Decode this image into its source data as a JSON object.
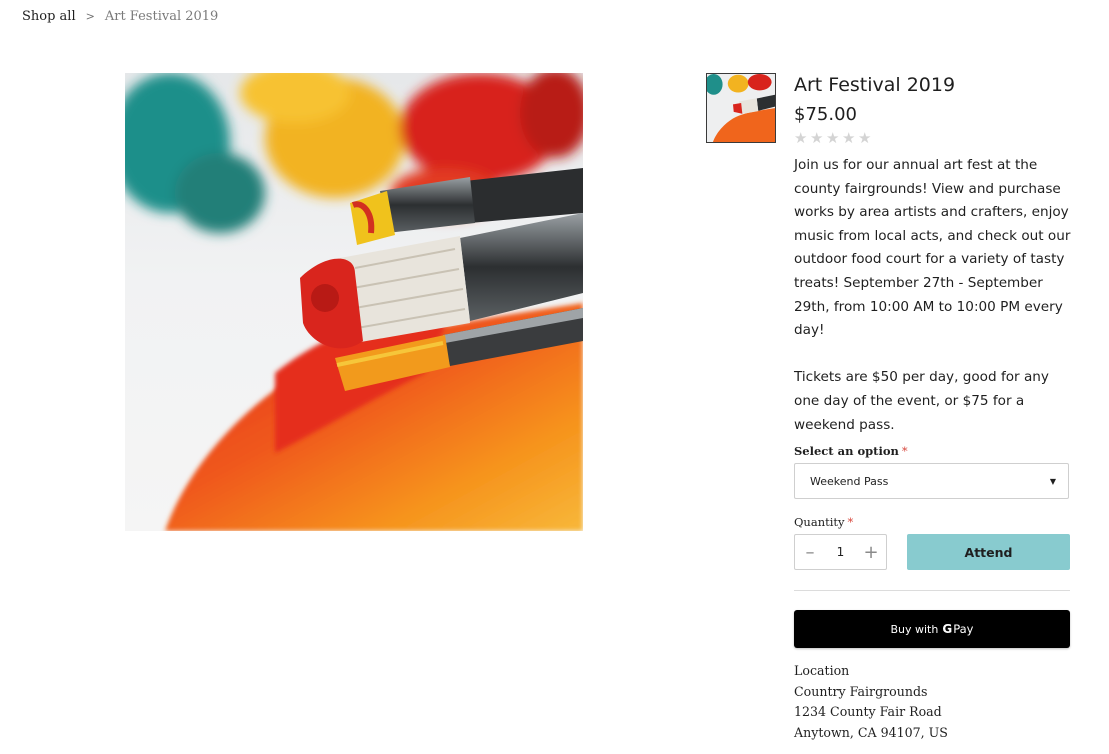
{
  "breadcrumb": {
    "shop_all": "Shop all",
    "separator": ">",
    "current": "Art Festival 2019"
  },
  "product": {
    "title": "Art Festival 2019",
    "price": "$75.00",
    "rating_stars": 5,
    "rating_value": 0,
    "description": [
      "Join us for our annual art fest at the county fairgrounds! View and purchase works by area artists and crafters, enjoy music from local acts, and check out our outdoor food court for a variety of tasty treats! September 27th - September 29th, from 10:00 AM to 10:00 PM every day!",
      "Tickets are $50 per day, good for any one day of the event, or $75 for a weekend pass."
    ],
    "image_icon": "paint-brushes-image"
  },
  "options": {
    "label": "Select an option",
    "required_mark": "*",
    "selected": "Weekend Pass",
    "caret": "▼"
  },
  "quantity": {
    "label": "Quantity",
    "required_mark": "*",
    "value": "1",
    "minus": "–",
    "plus": "+"
  },
  "actions": {
    "attend": "Attend",
    "gpay_prefix": "Buy with",
    "gpay_g": "G",
    "gpay_pay": "Pay"
  },
  "location": {
    "heading": "Location",
    "name": "Country Fairgrounds",
    "street": "1234 County Fair Road",
    "city": "Anytown, CA 94107, US"
  },
  "colors": {
    "accent": "#88cbcf",
    "required": "#d6443a",
    "star_empty": "#d4d4d4"
  }
}
